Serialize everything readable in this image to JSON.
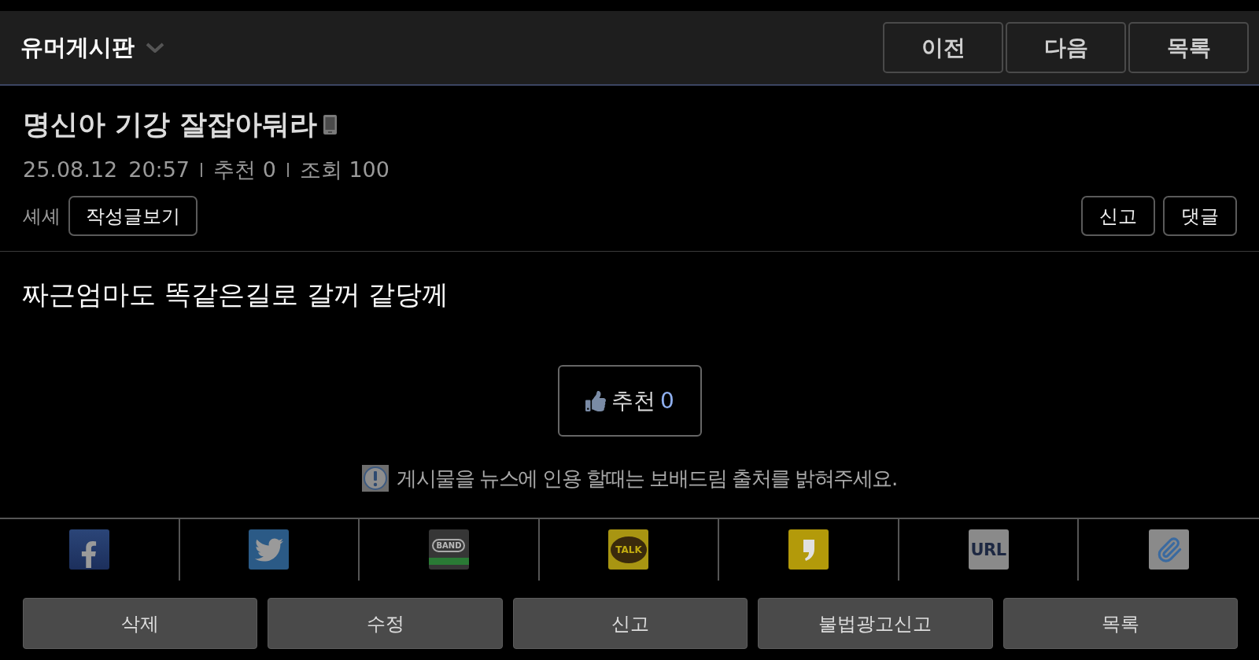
{
  "header": {
    "board_title": "유머게시판",
    "nav_buttons": [
      "이전",
      "다음",
      "목록"
    ]
  },
  "post": {
    "title": "명신아 기강 잘잡아둬라",
    "posted_from_mobile": true,
    "date": "25.08.12",
    "time": "20:57",
    "recommend": "추천 0",
    "views": "조회 100",
    "author": "셰셰",
    "author_posts_button": "작성글보기",
    "action_buttons": [
      "신고",
      "댓글"
    ],
    "body": "짜근엄마도 똑같은길로 갈꺼 같당께"
  },
  "recommend_button": {
    "label": "추천",
    "count": "0"
  },
  "notice": "게시물을 뉴스에 인용 할때는 보배드림 출처를 밝혀주세요.",
  "share_items": [
    {
      "kind": "facebook"
    },
    {
      "kind": "twitter"
    },
    {
      "kind": "band",
      "mark": "BAND"
    },
    {
      "kind": "talk",
      "mark": "TALK"
    },
    {
      "kind": "story"
    },
    {
      "kind": "url",
      "mark": "URL"
    },
    {
      "kind": "attach"
    }
  ],
  "bottom_buttons": [
    "삭제",
    "수정",
    "신고",
    "불법광고신고",
    "목록"
  ]
}
